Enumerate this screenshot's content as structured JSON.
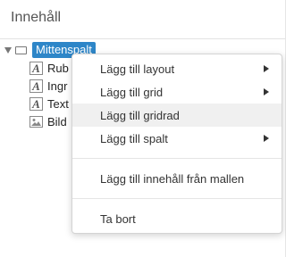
{
  "panel": {
    "title": "Innehåll"
  },
  "tree": {
    "root": {
      "label": "Mittenspalt"
    },
    "children": [
      {
        "label": "Rub",
        "icon": "text-format-icon"
      },
      {
        "label": "Ingr",
        "icon": "text-format-icon"
      },
      {
        "label": "Text",
        "icon": "text-format-icon"
      },
      {
        "label": "Bild",
        "icon": "image-icon"
      }
    ]
  },
  "context_menu": {
    "items": [
      {
        "label": "Lägg till layout",
        "submenu": true
      },
      {
        "label": "Lägg till grid",
        "submenu": true
      },
      {
        "label": "Lägg till gridrad",
        "submenu": false,
        "hover": true
      },
      {
        "label": "Lägg till spalt",
        "submenu": true
      },
      {
        "label": "Lägg till innehåll från mallen",
        "submenu": false
      },
      {
        "label": "Ta bort",
        "submenu": false
      }
    ]
  },
  "colors": {
    "selection": "#2e86c8",
    "hover": "#f0f0f0"
  }
}
